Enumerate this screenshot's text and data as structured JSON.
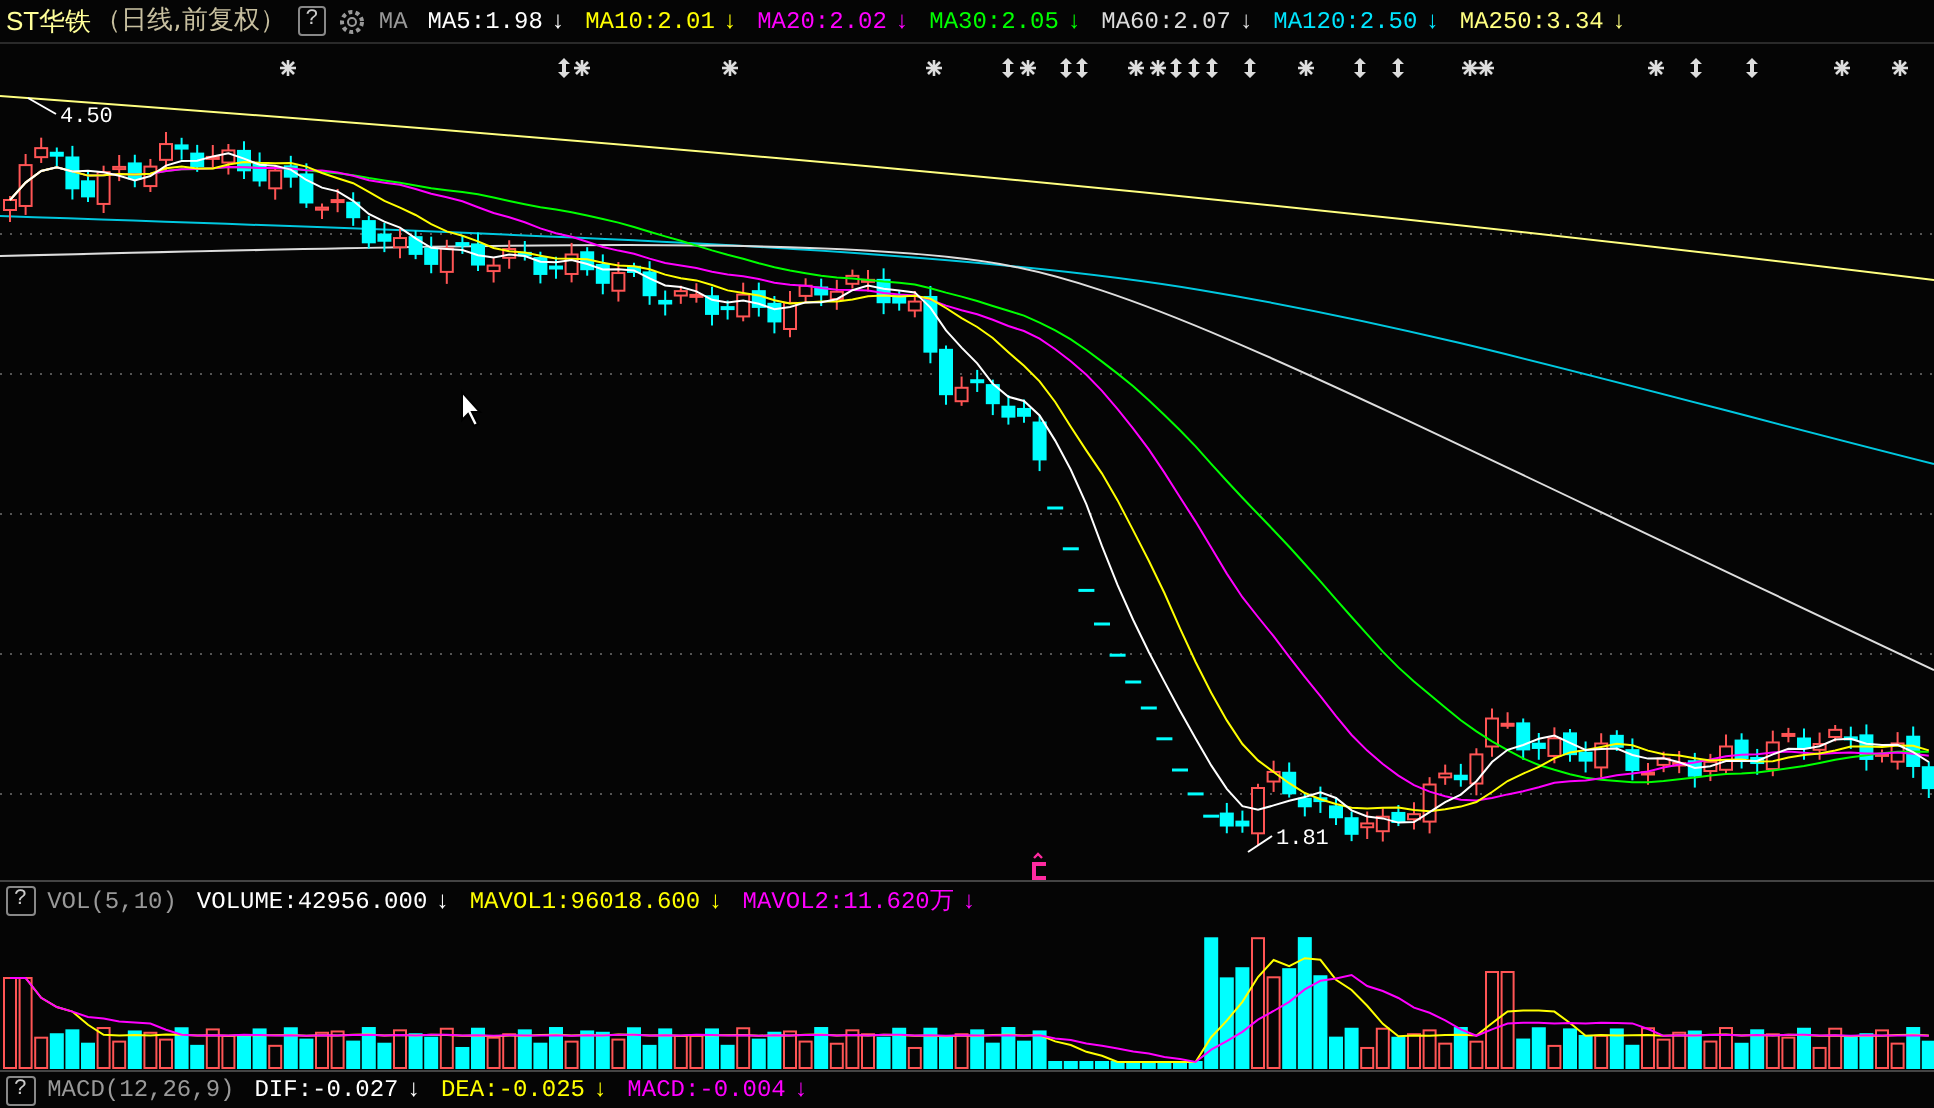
{
  "header": {
    "title": "ST华铁",
    "subtitle": "（日线,前复权）",
    "help": "?",
    "indicator": "MA",
    "values": [
      {
        "label": "MA5:1.98",
        "arrow": "↓",
        "color": "#ffffff"
      },
      {
        "label": "MA10:2.01",
        "arrow": "↓",
        "color": "#ffff00"
      },
      {
        "label": "MA20:2.02",
        "arrow": "↓",
        "color": "#ff00ff"
      },
      {
        "label": "MA30:2.05",
        "arrow": "↓",
        "color": "#00ff00"
      },
      {
        "label": "MA60:2.07",
        "arrow": "↓",
        "color": "#dddddd"
      },
      {
        "label": "MA120:2.50",
        "arrow": "↓",
        "color": "#00e5ff"
      },
      {
        "label": "MA250:3.34",
        "arrow": "↓",
        "color": "#ffff80"
      }
    ]
  },
  "chart": {
    "high_label": "4.50",
    "low_label": "1.81",
    "marks": [
      {
        "kind": "star"
      },
      {
        "kind": "updown"
      },
      {
        "kind": "star"
      },
      {
        "kind": "star"
      },
      {
        "kind": "star"
      },
      {
        "kind": "updown"
      },
      {
        "kind": "star"
      },
      {
        "kind": "updown"
      },
      {
        "kind": "updown"
      },
      {
        "kind": "star"
      },
      {
        "kind": "star"
      },
      {
        "kind": "updown"
      },
      {
        "kind": "updown"
      },
      {
        "kind": "updown"
      },
      {
        "kind": "updown"
      },
      {
        "kind": "star"
      },
      {
        "kind": "updown"
      },
      {
        "kind": "updown"
      },
      {
        "kind": "star"
      },
      {
        "kind": "star"
      },
      {
        "kind": "star"
      },
      {
        "kind": "updown"
      },
      {
        "kind": "updown"
      },
      {
        "kind": "star"
      },
      {
        "kind": "star"
      }
    ]
  },
  "volume_header": {
    "help": "?",
    "name": "VOL(5,10)",
    "values": [
      {
        "label": "VOLUME:42956.000",
        "arrow": "↓",
        "color": "#ffffff"
      },
      {
        "label": "MAVOL1:96018.600",
        "arrow": "↓",
        "color": "#ffff00"
      },
      {
        "label": "MAVOL2:11.620万",
        "arrow": "↓",
        "color": "#ff00ff"
      }
    ]
  },
  "macd_header": {
    "help": "?",
    "name": "MACD(12,26,9)",
    "values": [
      {
        "label": "DIF:-0.027",
        "arrow": "↓",
        "color": "#ffffff"
      },
      {
        "label": "DEA:-0.025",
        "arrow": "↓",
        "color": "#ffff00"
      },
      {
        "label": "MACD:-0.004",
        "arrow": "↓",
        "color": "#ff00ff"
      }
    ]
  }
}
